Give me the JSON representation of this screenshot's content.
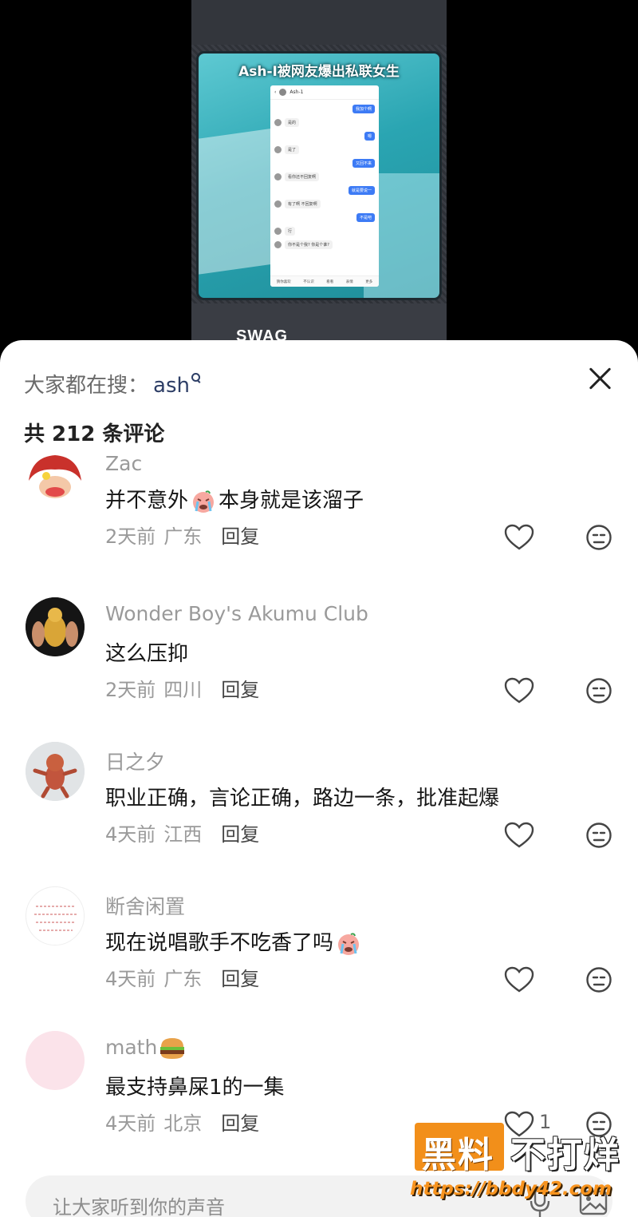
{
  "video": {
    "title": "Ash-I被网友爆出私联女生",
    "chat_header": "Ash-1",
    "chat_messages": [
      {
        "side": "right",
        "text": "我加个啊"
      },
      {
        "side": "left",
        "text": "是的"
      },
      {
        "side": "right",
        "text": "嗯"
      },
      {
        "side": "left",
        "text": "是了"
      },
      {
        "side": "right",
        "text": "又回不来"
      },
      {
        "side": "left",
        "text": "看你还不回复啊"
      },
      {
        "side": "right",
        "text": "就是要说一"
      },
      {
        "side": "left",
        "text": "有了啊 不回复啊"
      },
      {
        "side": "right",
        "text": "不是吧"
      },
      {
        "side": "left",
        "text": "行"
      },
      {
        "side": "left",
        "text": "你不是个我? 你是个谁?"
      }
    ],
    "chat_footer": [
      "猜你喜欢",
      "不认识",
      "看看",
      "表情",
      "更多"
    ],
    "swag_text": "SWAG"
  },
  "sheet": {
    "search_label": "大家都在搜：",
    "search_term": "ash",
    "count_text": "共 212 条评论"
  },
  "comments": [
    {
      "name": "Zac",
      "text_before": "并不意外",
      "emoji": "crying-face-emoji",
      "text_after": "本身就是该溜子",
      "time": "2天前",
      "location": "广东",
      "reply": "回复",
      "likes": ""
    },
    {
      "name": "Wonder Boy's Akumu Club",
      "text_before": "这么压抑",
      "emoji": "",
      "text_after": "",
      "time": "2天前",
      "location": "四川",
      "reply": "回复",
      "likes": ""
    },
    {
      "name": "日之夕",
      "text_before": "职业正确，言论正确，路边一条，批准起爆",
      "emoji": "",
      "text_after": "",
      "time": "4天前",
      "location": "江西",
      "reply": "回复",
      "likes": ""
    },
    {
      "name": "断舍闲置",
      "text_before": "现在说唱歌手不吃香了吗",
      "emoji": "crying-face-emoji",
      "text_after": "",
      "time": "4天前",
      "location": "广东",
      "reply": "回复",
      "likes": ""
    },
    {
      "name": "math",
      "name_emoji": "hamburger-emoji",
      "text_before": "最支持鼻屎1的一集",
      "emoji": "",
      "text_after": "",
      "time": "4天前",
      "location": "北京",
      "reply": "回复",
      "likes": "1"
    }
  ],
  "input": {
    "placeholder": "让大家听到你的声音"
  },
  "watermark": {
    "part1": "黑料",
    "part2": "不打烊",
    "url": "https://bbdy42.com"
  },
  "colors": {
    "accent_teal": "#2aa5b2",
    "watermark_orange": "#f28f1a",
    "meta_gray": "#9a9a9a"
  }
}
